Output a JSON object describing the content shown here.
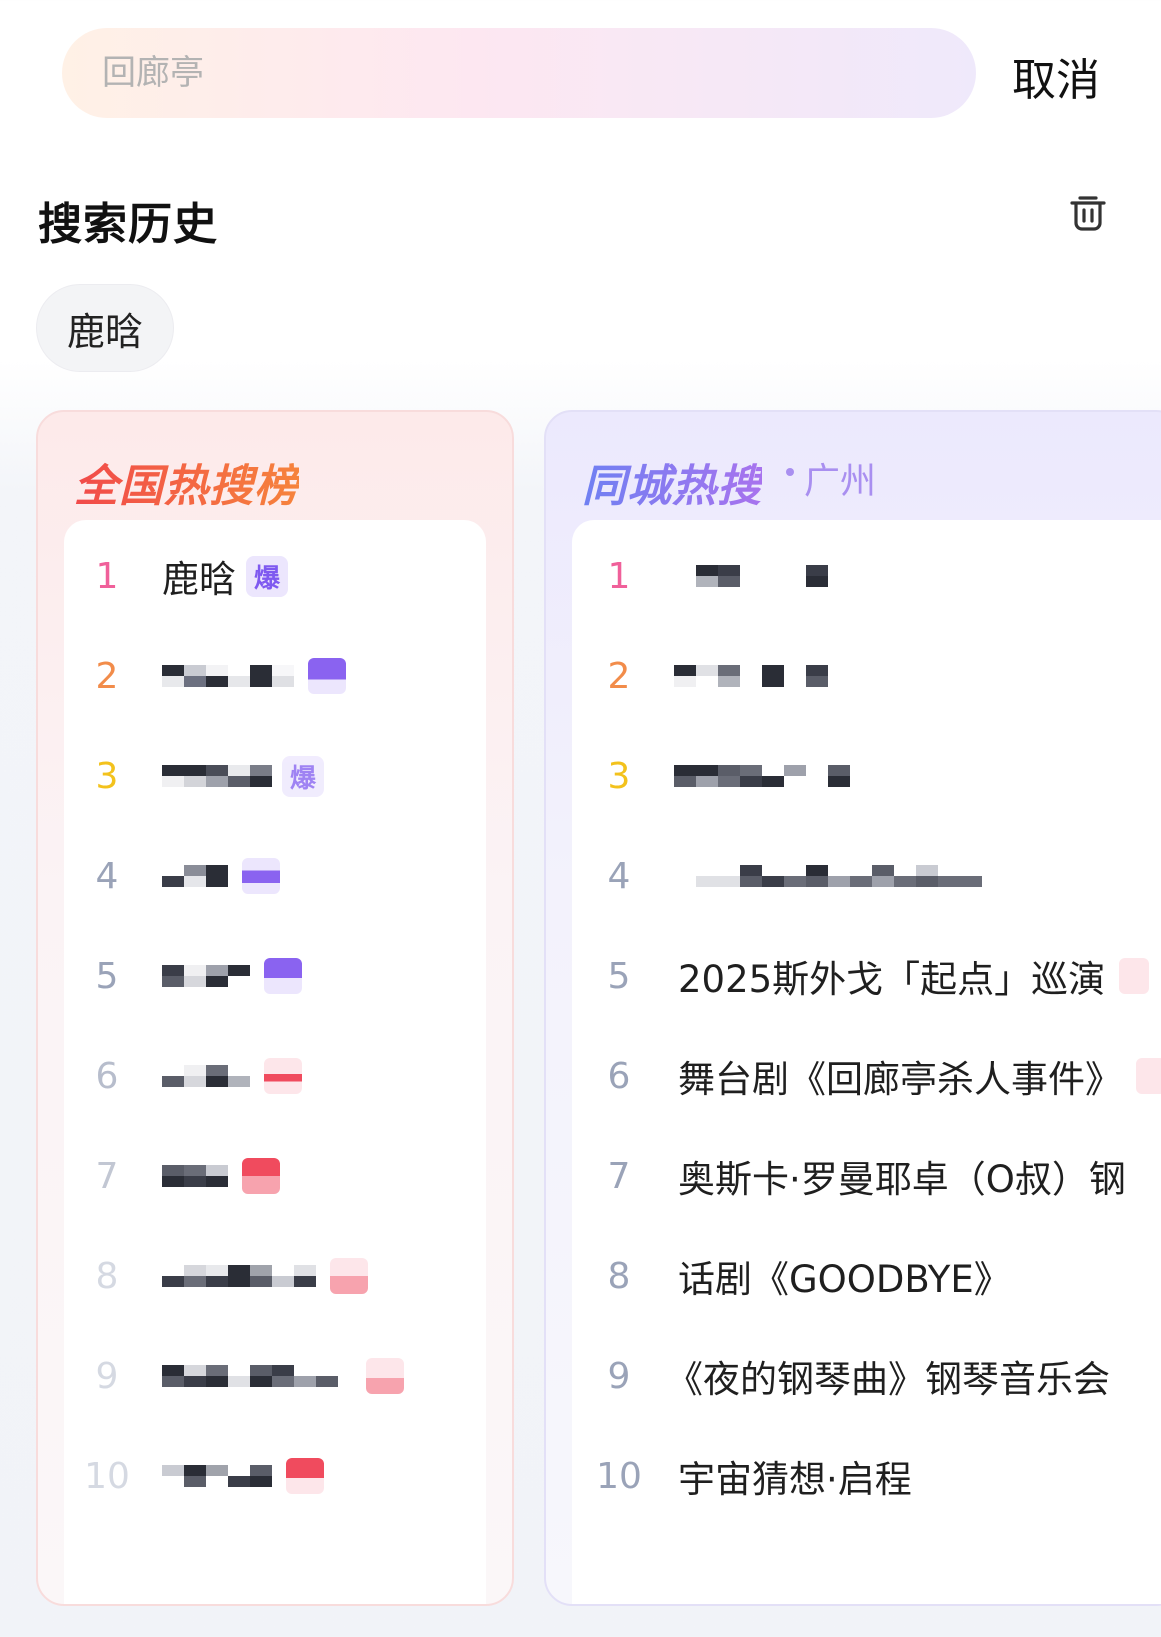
{
  "search": {
    "placeholder": "回廊亭",
    "cancel_label": "取消"
  },
  "history": {
    "title": "搜索历史",
    "items": [
      "鹿晗"
    ]
  },
  "national": {
    "title": "全国热搜榜",
    "items": [
      {
        "rank": "1",
        "text": "鹿晗",
        "badge": "爆"
      },
      {
        "rank": "2",
        "text": "",
        "badge": ""
      },
      {
        "rank": "3",
        "text": "",
        "badge": "爆"
      },
      {
        "rank": "4",
        "text": "",
        "badge": ""
      },
      {
        "rank": "5",
        "text": "",
        "badge": ""
      },
      {
        "rank": "6",
        "text": "",
        "badge": ""
      },
      {
        "rank": "7",
        "text": "",
        "badge": ""
      },
      {
        "rank": "8",
        "text": "",
        "badge": ""
      },
      {
        "rank": "9",
        "text": "",
        "badge": ""
      },
      {
        "rank": "10",
        "text": "",
        "badge": ""
      }
    ]
  },
  "city": {
    "title": "同城热搜",
    "city_name": "广州",
    "items": [
      {
        "rank": "1",
        "text": ""
      },
      {
        "rank": "2",
        "text": ""
      },
      {
        "rank": "3",
        "text": ""
      },
      {
        "rank": "4",
        "text": ""
      },
      {
        "rank": "5",
        "text": "2025斯外戈「起点」巡演"
      },
      {
        "rank": "6",
        "text": "舞台剧《回廊亭杀人事件》"
      },
      {
        "rank": "7",
        "text": "奥斯卡·罗曼耶卓（O叔）钢"
      },
      {
        "rank": "8",
        "text": "话剧《GOODBYE》"
      },
      {
        "rank": "9",
        "text": "《夜的钢琴曲》钢琴音乐会"
      },
      {
        "rank": "10",
        "text": "宇宙猜想·启程"
      }
    ]
  },
  "colors": {
    "rank1": "#f0609a",
    "rank2": "#f28c4a",
    "rank3": "#f3c21c",
    "rank_other": "#9aa3b8",
    "hot_badge": "#f04b5e",
    "explode_badge": "#7f5af0"
  }
}
